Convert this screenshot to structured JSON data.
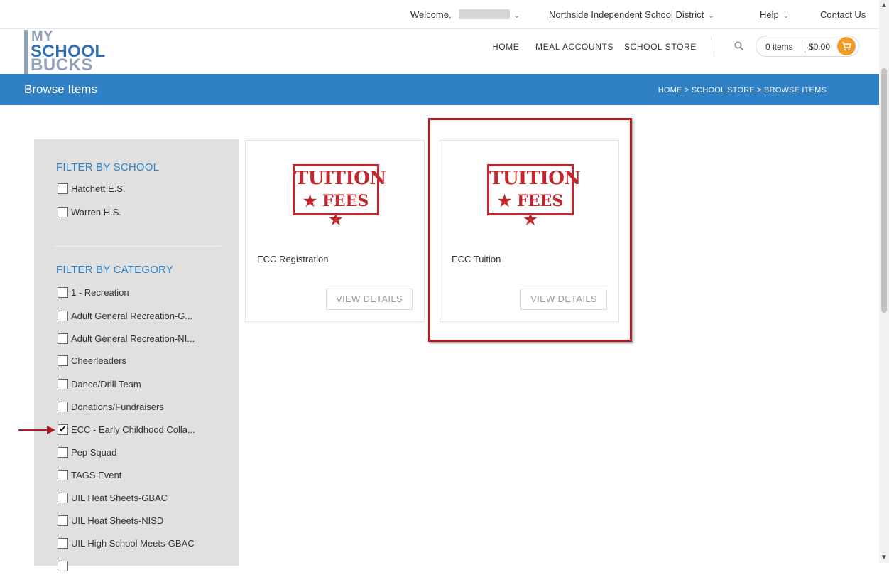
{
  "topbar": {
    "welcome": "Welcome,",
    "district": "Northside Independent School District",
    "help": "Help",
    "contact": "Contact Us"
  },
  "logo": {
    "line1": "MY",
    "line2": "SCHOOL",
    "line3": "BUCKS"
  },
  "nav": {
    "home": "HOME",
    "meal_accounts": "MEAL ACCOUNTS",
    "school_store": "SCHOOL STORE"
  },
  "cart": {
    "items": "0 items",
    "total": "$0.00"
  },
  "page": {
    "title": "Browse Items",
    "breadcrumb": "HOME  >  SCHOOL STORE  >  BROWSE ITEMS"
  },
  "filters": {
    "school_heading": "FILTER BY SCHOOL",
    "schools": [
      {
        "label": "Hatchett E.S.",
        "checked": false
      },
      {
        "label": "Warren H.S.",
        "checked": false
      }
    ],
    "category_heading": "FILTER BY CATEGORY",
    "categories": [
      {
        "label": "1 - Recreation",
        "checked": false
      },
      {
        "label": "Adult General Recreation-G...",
        "checked": false
      },
      {
        "label": "Adult General Recreation-NI...",
        "checked": false
      },
      {
        "label": "Cheerleaders",
        "checked": false
      },
      {
        "label": "Dance/Drill Team",
        "checked": false
      },
      {
        "label": "Donations/Fundraisers",
        "checked": false
      },
      {
        "label": "ECC - Early Childhood Colla...",
        "checked": true
      },
      {
        "label": "Pep Squad",
        "checked": false
      },
      {
        "label": "TAGS Event",
        "checked": false
      },
      {
        "label": "UIL Heat Sheets-GBAC",
        "checked": false
      },
      {
        "label": "UIL Heat Sheets-NISD",
        "checked": false
      },
      {
        "label": "UIL High School Meets-GBAC",
        "checked": false
      }
    ]
  },
  "products": [
    {
      "name": "ECC Registration",
      "image_line1": "TUITION",
      "image_line2": "★ FEES ★",
      "button": "VIEW DETAILS"
    },
    {
      "name": "ECC Tuition",
      "image_line1": "TUITION",
      "image_line2": "★ FEES ★",
      "button": "VIEW DETAILS"
    }
  ],
  "colors": {
    "brand_blue": "#2f80c5",
    "cart_orange": "#f29a26",
    "annotation_red": "#b11a1f"
  }
}
